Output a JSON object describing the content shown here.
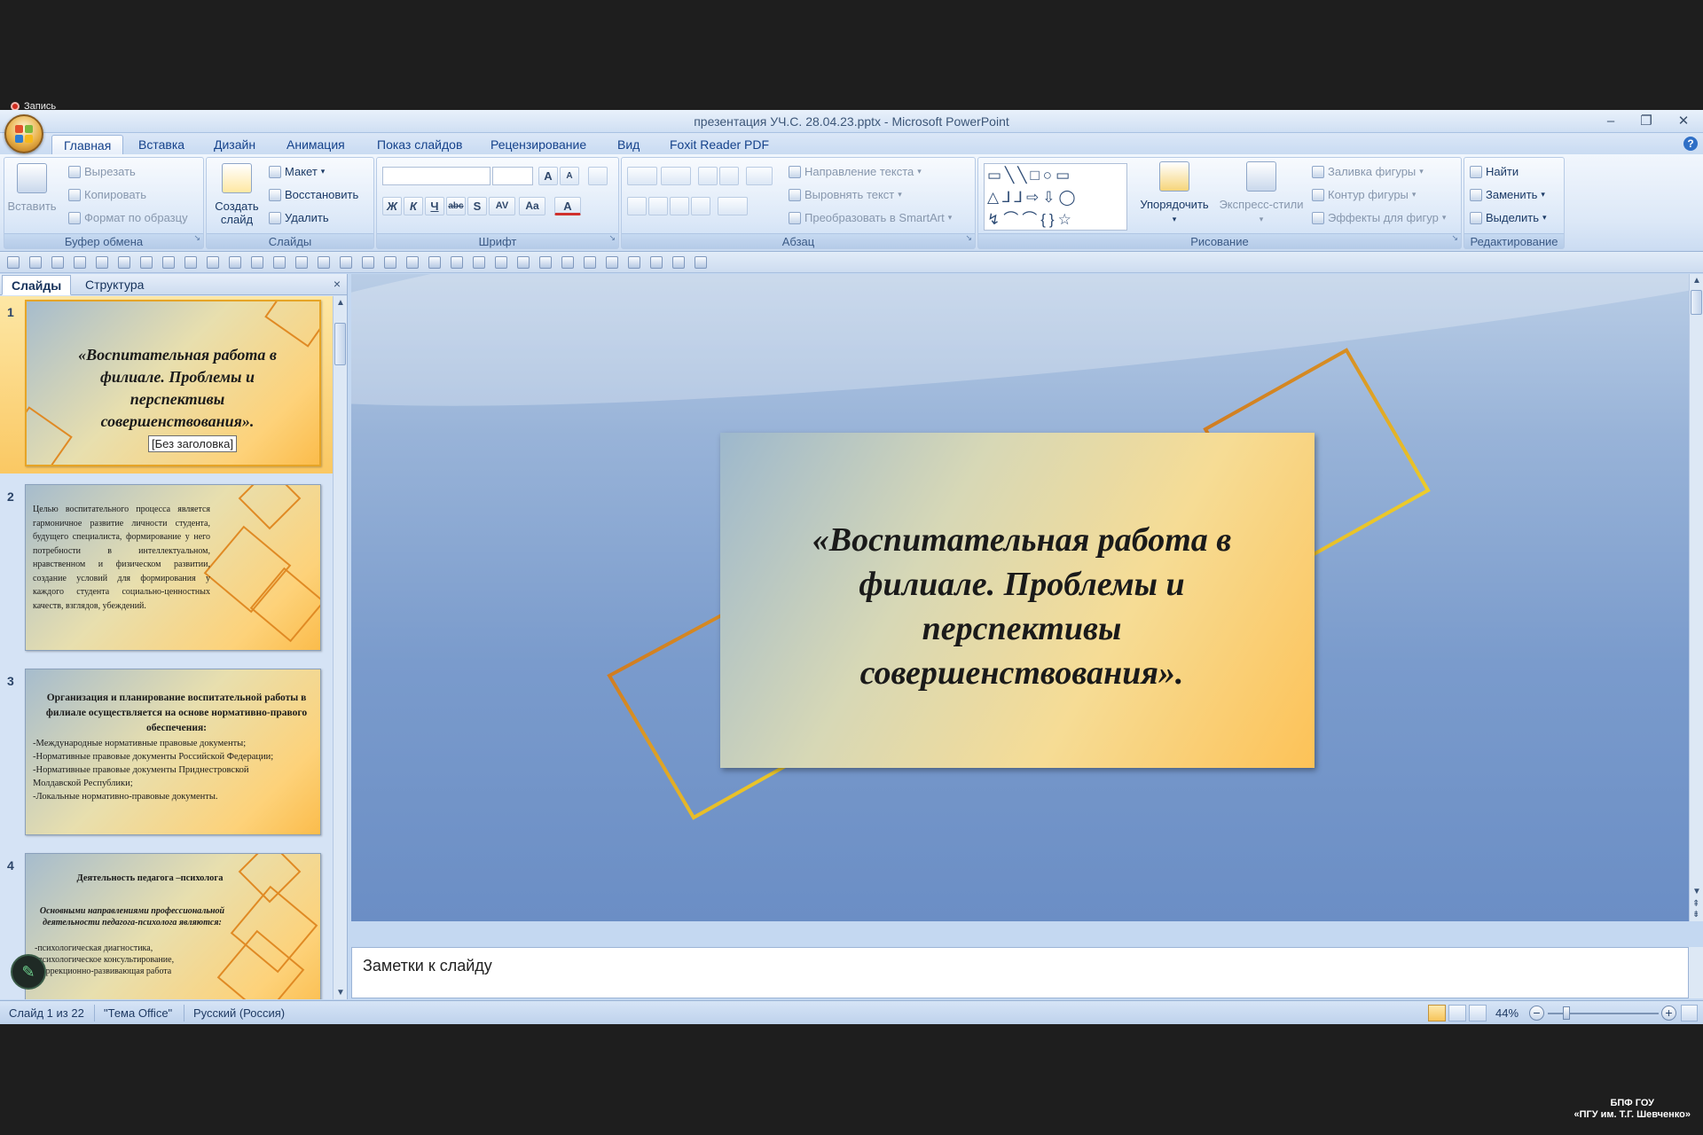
{
  "recording": {
    "label": "Запись"
  },
  "window": {
    "title": "презентация УЧ.С. 28.04.23.pptx - Microsoft PowerPoint",
    "minimize": "–",
    "restore": "❐",
    "close": "✕"
  },
  "tabs": [
    "Главная",
    "Вставка",
    "Дизайн",
    "Анимация",
    "Показ слайдов",
    "Рецензирование",
    "Вид",
    "Foxit Reader PDF"
  ],
  "help_icon": "?",
  "ribbon": {
    "clipboard": {
      "label": "Буфер обмена",
      "paste": "Вставить",
      "cut": "Вырезать",
      "copy": "Копировать",
      "format_painter": "Формат по образцу"
    },
    "slides": {
      "label": "Слайды",
      "new_slide": "Создать слайд",
      "layout": "Макет",
      "reset": "Восстановить",
      "delete": "Удалить"
    },
    "font": {
      "label": "Шрифт",
      "bold": "Ж",
      "italic": "К",
      "underline": "Ч",
      "strike": "abc",
      "shadow": "S",
      "spacing": "AV",
      "case": "Aa",
      "grow": "A",
      "shrink": "A",
      "color": "A"
    },
    "paragraph": {
      "label": "Абзац",
      "text_direction": "Направление текста",
      "align_text": "Выровнять текст",
      "smartart": "Преобразовать в SmartArt"
    },
    "drawing": {
      "label": "Рисование",
      "arrange": "Упорядочить",
      "quick_styles": "Экспресс-стили",
      "fill": "Заливка фигуры",
      "outline": "Контур фигуры",
      "effects": "Эффекты для фигур"
    },
    "editing": {
      "label": "Редактирование",
      "find": "Найти",
      "replace": "Заменить",
      "select": "Выделить"
    }
  },
  "left_panel": {
    "tab_slides": "Слайды",
    "tab_outline": "Структура",
    "close": "×"
  },
  "thumbnails": [
    {
      "num": "1",
      "text": "«Воспитательная работа в филиале. Проблемы и перспективы совершенствования»."
    },
    {
      "num": "2",
      "text": "Целью воспитательного процесса является гармоничное развитие личности студента, будущего специалиста, формирование у него потребности в интеллектуальном, нравственном и физическом развитии, создание условий для формирования у каждого студента социально-ценностных качеств, взглядов, убеждений."
    },
    {
      "num": "3",
      "title": "Организация и планирование воспитательной работы в филиале осуществляется на основе нормативно-правого обеспечения:",
      "items": [
        "-Международные нормативные правовые документы;",
        "-Нормативные правовые документы Российской Федерации;",
        "-Нормативные правовые документы Приднестровской Молдавской Республики;",
        "-Локальные нормативно-правовые документы."
      ]
    },
    {
      "num": "4",
      "title": "Деятельность педагога –психолога",
      "subtitle": "Основными направлениями профессиональной деятельности педагога-психолога являются:",
      "items": [
        "-психологическая диагностика,",
        "-психологическое консультирование,",
        "-коррекционно-развивающая работа"
      ]
    }
  ],
  "tooltip": "[Без заголовка]",
  "main_slide": {
    "title": "«Воспитательная работа в филиале. Проблемы и перспективы совершенствования»."
  },
  "notes": {
    "placeholder": "Заметки к слайду"
  },
  "status": {
    "slide": "Слайд 1 из 22",
    "theme": "\"Тема Office\"",
    "language": "Русский (Россия)",
    "zoom": "44%",
    "zoom_minus": "−",
    "zoom_plus": "+"
  },
  "brand": {
    "line1": "БПФ ГОУ",
    "line2": "«ПГУ им. Т.Г. Шевченко»"
  }
}
